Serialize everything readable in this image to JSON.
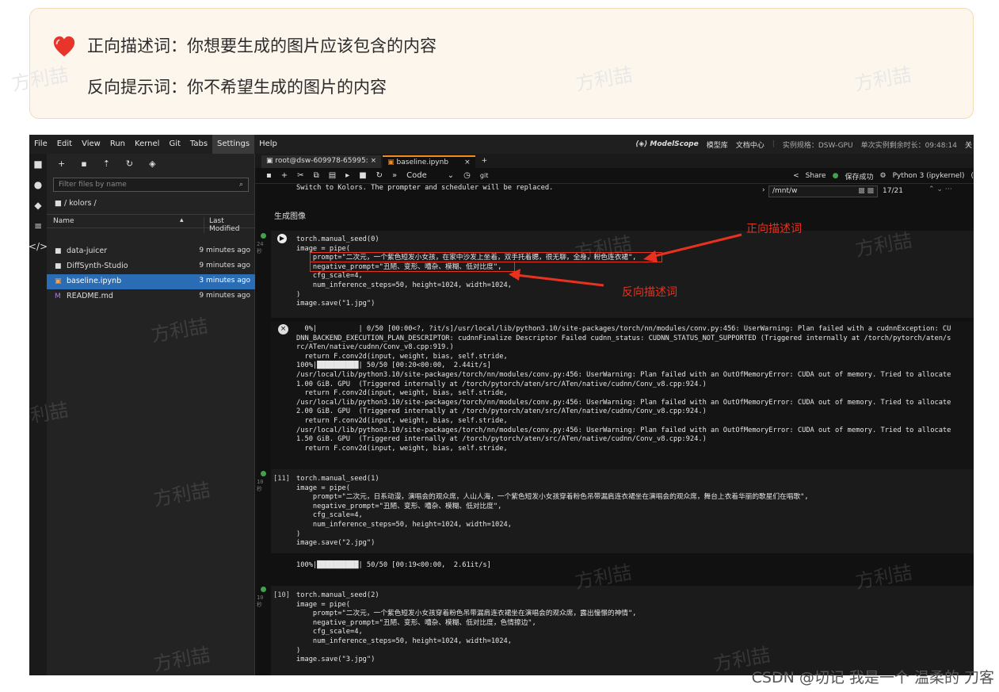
{
  "tip": {
    "line1": "正向描述词：你想要生成的图片应该包含的内容",
    "line2": "反向提示词：你不希望生成的图片的内容"
  },
  "watermark": "方利喆",
  "footer_credit": "CSDN @切记 我是一个 温柔的 刀客",
  "menubar": {
    "items": [
      "File",
      "Edit",
      "View",
      "Run",
      "Kernel",
      "Git",
      "Tabs",
      "Settings",
      "Help"
    ],
    "active": "Settings",
    "brand": "ModelScope",
    "links": [
      "模型库",
      "文档中心"
    ],
    "spec": "实例规格：DSW-GPU",
    "remaining": "单次实例剩余时长：09:48:14",
    "cut": "关"
  },
  "filebrowser": {
    "filter_placeholder": "Filter files by name",
    "breadcrumb": "■ / kolors /",
    "col_name": "Name",
    "col_modified": "Last Modified",
    "files": [
      {
        "name": "data-juicer",
        "modified": "9 minutes ago",
        "icon": "■"
      },
      {
        "name": "DiffSynth-Studio",
        "modified": "9 minutes ago",
        "icon": "■"
      },
      {
        "name": "baseline.ipynb",
        "modified": "3 minutes ago",
        "icon": "▣"
      },
      {
        "name": "README.md",
        "modified": "9 minutes ago",
        "icon": "M"
      }
    ]
  },
  "tabs": [
    {
      "label": "root@dsw-609978-65995:"
    },
    {
      "label": "baseline.ipynb"
    }
  ],
  "notebook_toolbar": {
    "cell_type": "Code",
    "git": "git",
    "share": "Share",
    "saved": "保存成功",
    "kernel": "Python 3 (ipykernel)"
  },
  "find": {
    "value": "/mnt/w",
    "count": "17/21"
  },
  "notebook": {
    "top_output": "Switch to Kolors. The prompter and scheduler will be replaced.",
    "section_heading": "生成图像",
    "cell1_gutter": "24\n秒",
    "cell1_code": "torch.manual_seed(0)\nimage = pipe(\n    prompt=\"二次元，一个紫色短发小女孩，在家中沙发上坐着，双手托着腮，很无聊，全身，粉色连衣裙\",\n    negative_prompt=\"丑陋、变形、嘈杂、模糊、低对比度\",\n    cfg_scale=4,\n    num_inference_steps=50, height=1024, width=1024,\n)\nimage.save(\"1.jpg\")",
    "cell1_output": "  0%|          | 0/50 [00:00<?, ?it/s]/usr/local/lib/python3.10/site-packages/torch/nn/modules/conv.py:456: UserWarning: Plan failed with a cudnnException: CU\nDNN_BACKEND_EXECUTION_PLAN_DESCRIPTOR: cudnnFinalize Descriptor Failed cudnn_status: CUDNN_STATUS_NOT_SUPPORTED (Triggered internally at /torch/pytorch/aten/s\nrc/ATen/native/cudnn/Conv_v8.cpp:919.)\n  return F.conv2d(input, weight, bias, self.stride,\n100%|██████████| 50/50 [00:20<00:00,  2.44it/s]\n/usr/local/lib/python3.10/site-packages/torch/nn/modules/conv.py:456: UserWarning: Plan failed with an OutOfMemoryError: CUDA out of memory. Tried to allocate\n1.00 GiB. GPU  (Triggered internally at /torch/pytorch/aten/src/ATen/native/cudnn/Conv_v8.cpp:924.)\n  return F.conv2d(input, weight, bias, self.stride,\n/usr/local/lib/python3.10/site-packages/torch/nn/modules/conv.py:456: UserWarning: Plan failed with an OutOfMemoryError: CUDA out of memory. Tried to allocate\n2.00 GiB. GPU  (Triggered internally at /torch/pytorch/aten/src/ATen/native/cudnn/Conv_v8.cpp:924.)\n  return F.conv2d(input, weight, bias, self.stride,\n/usr/local/lib/python3.10/site-packages/torch/nn/modules/conv.py:456: UserWarning: Plan failed with an OutOfMemoryError: CUDA out of memory. Tried to allocate\n1.50 GiB. GPU  (Triggered internally at /torch/pytorch/aten/src/ATen/native/cudnn/Conv_v8.cpp:924.)\n  return F.conv2d(input, weight, bias, self.stride,",
    "cell2_prompt": "[11]",
    "cell2_gutter": "10\n秒",
    "cell2_code": "torch.manual_seed(1)\nimage = pipe(\n    prompt=\"二次元，日系动漫，演唱会的观众席，人山人海，一个紫色短发小女孩穿着粉色吊带漏肩连衣裙坐在演唱会的观众席，舞台上衣着华丽的歌星们在唱歌\",\n    negative_prompt=\"丑陋、变形、嘈杂、模糊、低对比度\",\n    cfg_scale=4,\n    num_inference_steps=50, height=1024, width=1024,\n)\nimage.save(\"2.jpg\")",
    "cell2_output": "100%|██████████| 50/50 [00:19<00:00,  2.61it/s]",
    "cell3_prompt": "[10]",
    "cell3_gutter": "10\n秒",
    "cell3_code": "torch.manual_seed(2)\nimage = pipe(\n    prompt=\"二次元，一个紫色短发小女孩穿着粉色吊带漏肩连衣裙坐在演唱会的观众席，露出憧憬的神情\",\n    negative_prompt=\"丑陋、变形、嘈杂、模糊、低对比度，色情擦边\",\n    cfg_scale=4,\n    num_inference_steps=50, height=1024, width=1024,\n)\nimage.save(\"3.jpg\")"
  },
  "annotations": {
    "positive": "正向描述词",
    "negative": "反向描述词",
    "color": "#e8321f"
  }
}
